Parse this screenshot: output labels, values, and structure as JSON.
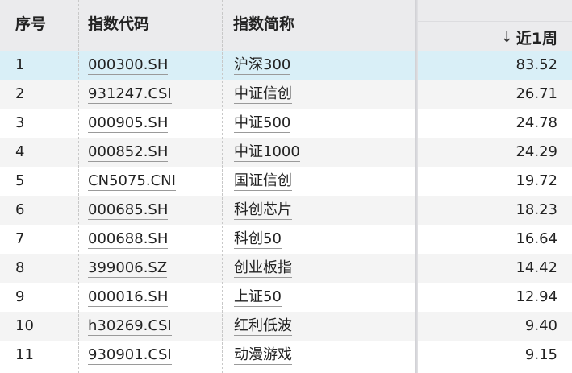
{
  "columns": {
    "seq": "序号",
    "code": "指数代码",
    "name": "指数简称",
    "week": "近1周",
    "sort_icon": "arrow-down-icon"
  },
  "rows": [
    {
      "seq": "1",
      "code": "000300.SH",
      "name": "沪深300",
      "week": "83.52"
    },
    {
      "seq": "2",
      "code": "931247.CSI",
      "name": "中证信创",
      "week": "26.71"
    },
    {
      "seq": "3",
      "code": "000905.SH",
      "name": "中证500",
      "week": "24.78"
    },
    {
      "seq": "4",
      "code": "000852.SH",
      "name": "中证1000",
      "week": "24.29"
    },
    {
      "seq": "5",
      "code": "CN5075.CNI",
      "name": "国证信创",
      "week": "19.72"
    },
    {
      "seq": "6",
      "code": "000685.SH",
      "name": "科创芯片",
      "week": "18.23"
    },
    {
      "seq": "7",
      "code": "000688.SH",
      "name": "科创50",
      "week": "16.64"
    },
    {
      "seq": "8",
      "code": "399006.SZ",
      "name": "创业板指",
      "week": "14.42"
    },
    {
      "seq": "9",
      "code": "000016.SH",
      "name": "上证50",
      "week": "12.94"
    },
    {
      "seq": "10",
      "code": "h30269.CSI",
      "name": "红利低波",
      "week": "9.40"
    },
    {
      "seq": "11",
      "code": "930901.CSI",
      "name": "动漫游戏",
      "week": "9.15"
    }
  ],
  "colors": {
    "header_bg": "#ebebed",
    "selected_row_bg": "#d9eff7",
    "alt_row_bg": "#f4f4f4"
  }
}
